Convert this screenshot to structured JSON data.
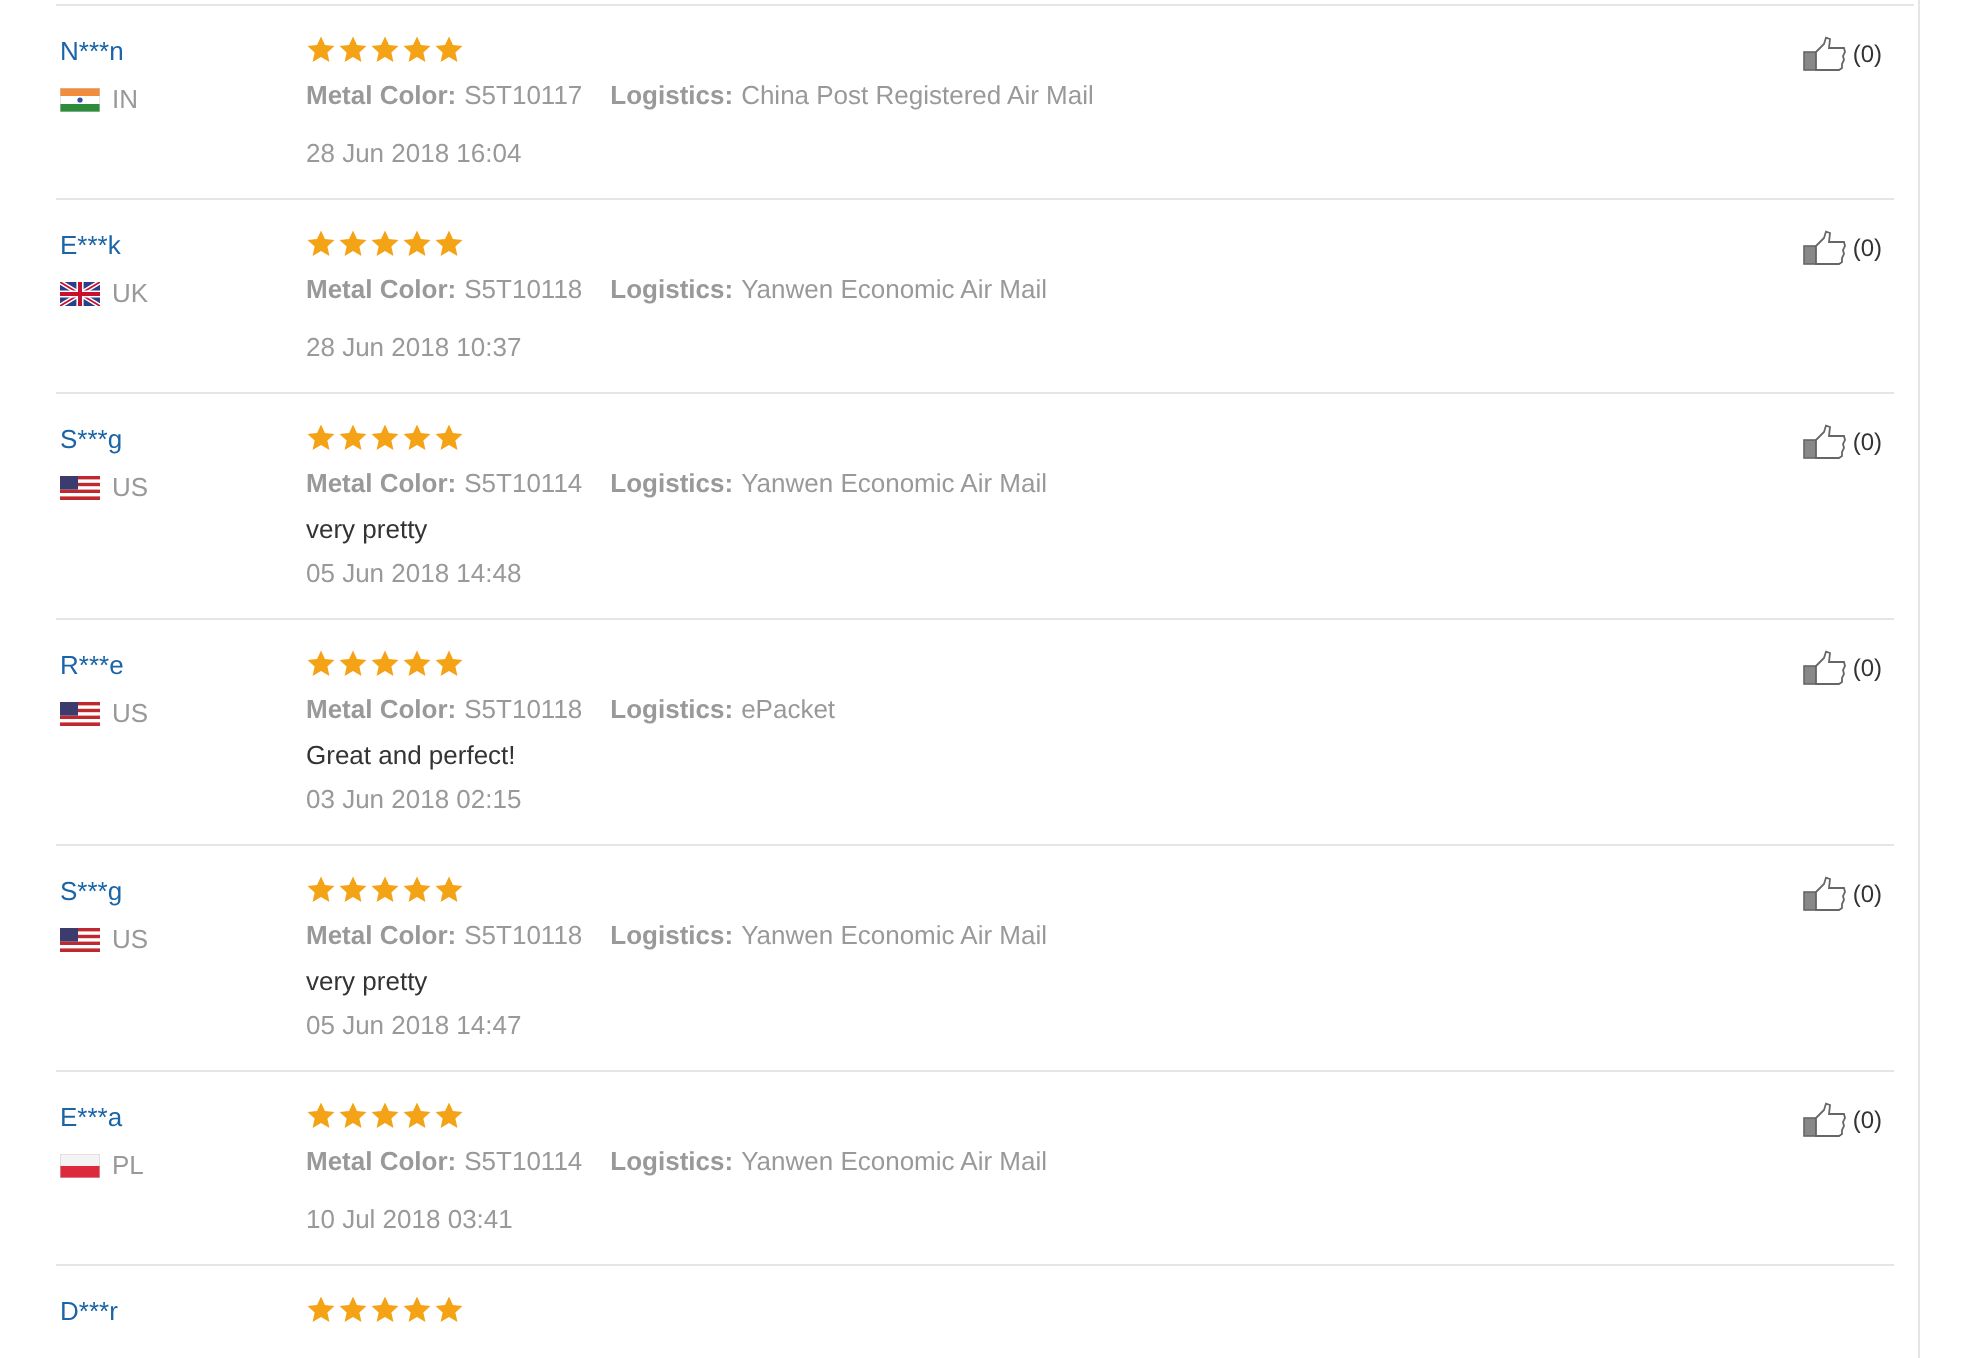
{
  "reviews": [
    {
      "name": "N***n",
      "kind": "in",
      "country": "IN",
      "stars": 5,
      "color_label": "Metal Color:",
      "color_value": "S5T10117",
      "logistics_label": "Logistics:",
      "logistics_value": "China Post Registered Air Mail",
      "date": "28 Jun 2018 16:04",
      "likes": "(0)"
    },
    {
      "name": "E***k",
      "kind": "uk",
      "country": "UK",
      "stars": 5,
      "color_label": "Metal Color:",
      "color_value": "S5T10118",
      "logistics_label": "Logistics:",
      "logistics_value": "Yanwen Economic Air Mail",
      "date": "28 Jun 2018 10:37",
      "likes": "(0)"
    },
    {
      "name": "S***g",
      "kind": "us",
      "country": "US",
      "stars": 5,
      "color_label": "Metal Color:",
      "color_value": "S5T10114",
      "logistics_label": "Logistics:",
      "logistics_value": "Yanwen Economic Air Mail",
      "comment": "very pretty",
      "date": "05 Jun 2018 14:48",
      "likes": "(0)"
    },
    {
      "name": "R***e",
      "kind": "us",
      "country": "US",
      "stars": 5,
      "color_label": "Metal Color:",
      "color_value": "S5T10118",
      "logistics_label": "Logistics:",
      "logistics_value": "ePacket",
      "comment": "Great and perfect!",
      "date": "03 Jun 2018 02:15",
      "likes": "(0)"
    },
    {
      "name": "S***g",
      "kind": "us",
      "country": "US",
      "stars": 5,
      "color_label": "Metal Color:",
      "color_value": "S5T10118",
      "logistics_label": "Logistics:",
      "logistics_value": "Yanwen Economic Air Mail",
      "comment": "very pretty",
      "date": "05 Jun 2018 14:47",
      "likes": "(0)"
    },
    {
      "name": "E***a",
      "kind": "pl",
      "country": "PL",
      "stars": 5,
      "color_label": "Metal Color:",
      "color_value": "S5T10114",
      "logistics_label": "Logistics:",
      "logistics_value": "Yanwen Economic Air Mail",
      "date": "10 Jul 2018 03:41",
      "likes": "(0)"
    },
    {
      "name": "D***r",
      "stars": 5
    }
  ]
}
